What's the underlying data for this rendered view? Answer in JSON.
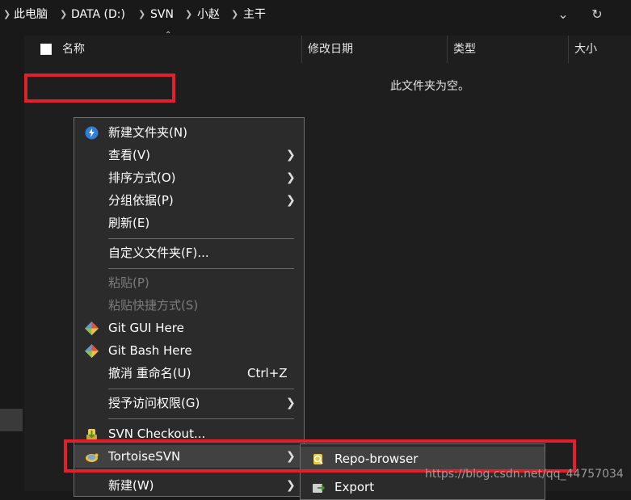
{
  "breadcrumb": [
    "此电脑",
    "DATA (D:)",
    "SVN",
    "小赵",
    "主干"
  ],
  "icons": {
    "breadcrumb_separator": "chevron-right-icon",
    "dropdown": "chevron-down-icon",
    "refresh": "refresh-icon"
  },
  "columns": [
    "名称",
    "修改日期",
    "类型",
    "大小"
  ],
  "empty_message": "此文件夹为空。",
  "context_menu": {
    "new_folder": "新建文件夹(N)",
    "view": "查看(V)",
    "sort_by": "排序方式(O)",
    "group_by": "分组依据(P)",
    "refresh": "刷新(E)",
    "customize_folder": "自定义文件夹(F)...",
    "paste": "粘贴(P)",
    "paste_shortcut": "粘贴快捷方式(S)",
    "git_gui": "Git GUI Here",
    "git_bash": "Git Bash Here",
    "undo_rename": "撤消 重命名(U)",
    "undo_shortcut": "Ctrl+Z",
    "grant_access": "授予访问权限(G)",
    "svn_checkout": "SVN Checkout...",
    "tortoisesvn": "TortoiseSVN",
    "new": "新建(W)"
  },
  "submenu": {
    "repo_browser": "Repo-browser",
    "export": "Export"
  },
  "watermark": "https://blog.csdn.net/qq_44757034",
  "colors": {
    "highlight_red": "#e0202a",
    "menu_bg": "#2b2b2b",
    "window_bg": "#1e1e1e"
  }
}
